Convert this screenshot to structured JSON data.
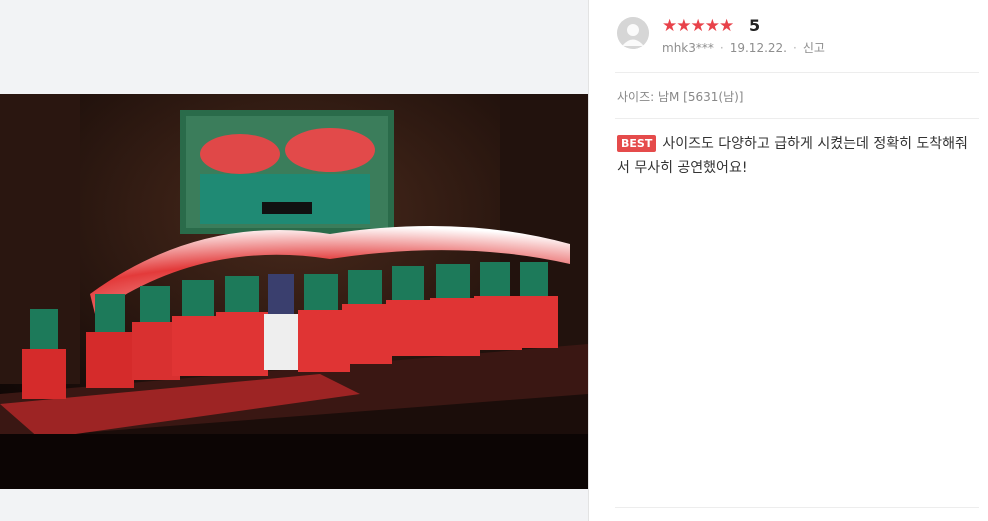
{
  "review": {
    "stars": "★★★★★",
    "score": "5",
    "user": "mhk3***",
    "date": "19.12.22.",
    "report_label": "신고",
    "option": "사이즈: 남M [5631(남)]",
    "best_badge": "BEST",
    "text": "사이즈도 다양하고 급하게 시켰는데 정확히 도착해줘서 무사히 공연했어요!"
  },
  "icons": {
    "avatar": "user-avatar-icon",
    "rating": "star-icon"
  },
  "colors": {
    "star": "#e8424a",
    "best_badge": "#e54b4b",
    "left_panel": "#f2f3f5"
  }
}
